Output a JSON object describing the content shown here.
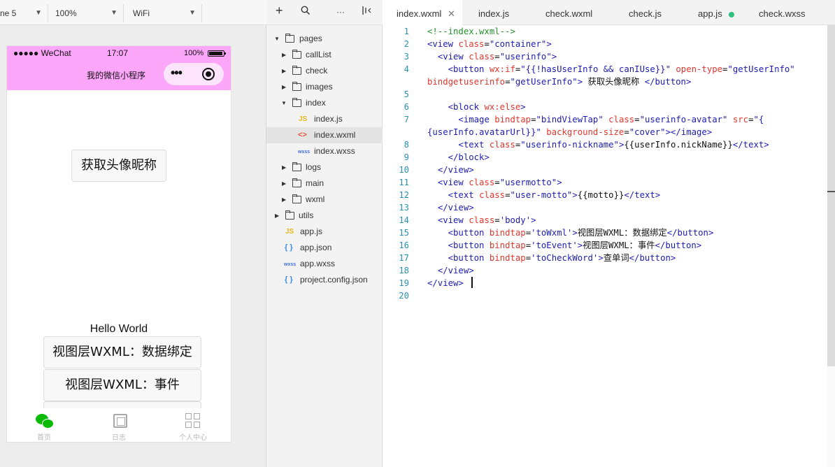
{
  "simulator": {
    "device": "ne 5",
    "zoom": "100%",
    "network": "WiFi",
    "status": {
      "carrier": "●●●●● WeChat",
      "time": "17:07",
      "battery": "100%"
    },
    "nav_title": "我的微信小程序",
    "page": {
      "avatar_button": "获取头像昵称",
      "motto": "Hello World",
      "buttons": [
        "视图层WXML：数据绑定",
        "视图层WXML：事件",
        ""
      ]
    },
    "tabbar": [
      {
        "label": "首页",
        "icon": "wechat-icon"
      },
      {
        "label": "日志",
        "icon": "chip-icon"
      },
      {
        "label": "个人中心",
        "icon": "grid-icon"
      }
    ],
    "colors": {
      "navbar": "#fca6fa",
      "tab_active": "#09bb07"
    }
  },
  "explorer": {
    "tree": [
      {
        "name": "pages",
        "type": "folder",
        "open": true
      },
      {
        "name": "callList",
        "type": "folder",
        "open": false
      },
      {
        "name": "check",
        "type": "folder",
        "open": false
      },
      {
        "name": "images",
        "type": "folder",
        "open": false
      },
      {
        "name": "index",
        "type": "folder",
        "open": true
      },
      {
        "name": "index.js",
        "type": "js"
      },
      {
        "name": "index.wxml",
        "type": "wxml",
        "selected": true
      },
      {
        "name": "index.wxss",
        "type": "wxss"
      },
      {
        "name": "logs",
        "type": "folder",
        "open": false
      },
      {
        "name": "main",
        "type": "folder",
        "open": false
      },
      {
        "name": "wxml",
        "type": "folder",
        "open": false
      },
      {
        "name": "utils",
        "type": "folder",
        "open": false
      },
      {
        "name": "app.js",
        "type": "js"
      },
      {
        "name": "app.json",
        "type": "json"
      },
      {
        "name": "app.wxss",
        "type": "wxss"
      },
      {
        "name": "project.config.json",
        "type": "json"
      }
    ]
  },
  "editor": {
    "tabs": [
      {
        "label": "index.wxml",
        "active": true,
        "closable": true
      },
      {
        "label": "index.js"
      },
      {
        "label": "check.wxml"
      },
      {
        "label": "check.js"
      },
      {
        "label": "app.js",
        "modified": true
      },
      {
        "label": "check.wxss"
      }
    ],
    "line_numbers": [
      "1",
      "2",
      "3",
      "4",
      "",
      "5",
      "6",
      "7",
      "",
      "8",
      "9",
      "10",
      "11",
      "12",
      "13",
      "14",
      "15",
      "16",
      "17",
      "18",
      "19",
      "20"
    ]
  }
}
